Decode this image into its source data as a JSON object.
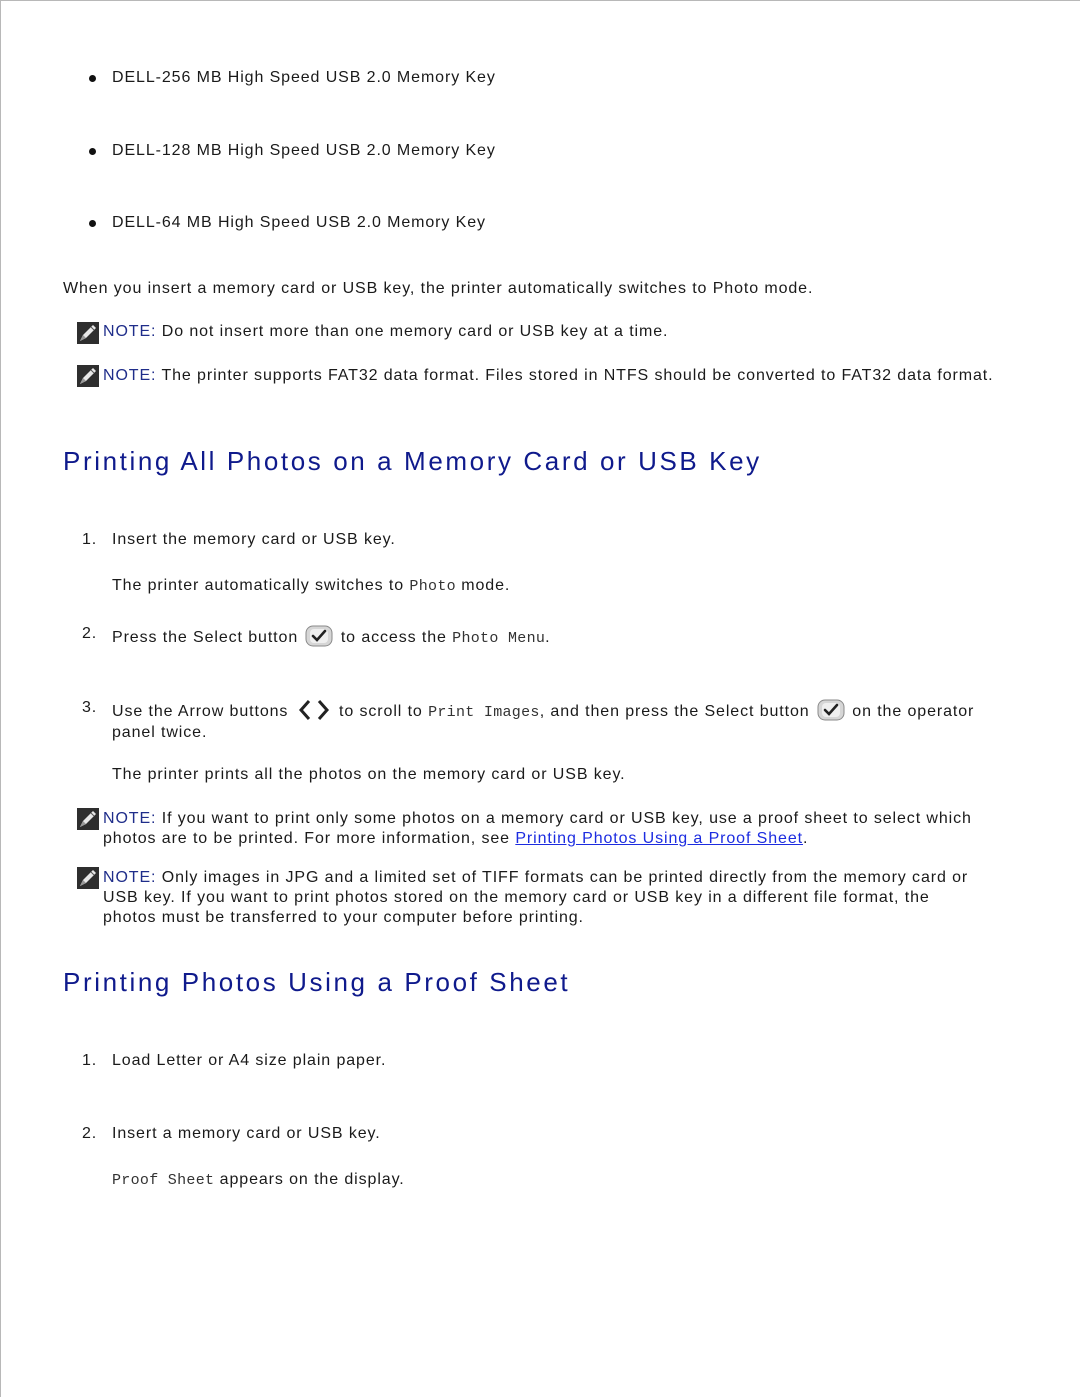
{
  "memory_keys": [
    "DELL-256 MB High Speed USB 2.0 Memory Key",
    "DELL-128 MB High Speed USB 2.0 Memory Key",
    "DELL-64 MB High Speed USB 2.0 Memory Key"
  ],
  "intro": {
    "before": "When you insert a memory card or USB key, the printer automatically switches to ",
    "mode": "Photo",
    "after": " mode."
  },
  "notes_top": [
    {
      "label": "NOTE:",
      "text": " Do not insert more than one memory card or USB key at a time."
    },
    {
      "label": "NOTE:",
      "text": " The printer supports FAT32 data format. Files stored in NTFS should be converted to FAT32 data format."
    }
  ],
  "section1": {
    "heading": "Printing All Photos on a Memory Card or USB Key",
    "step1": {
      "num": "1.",
      "text": "Insert the memory card or USB key."
    },
    "step1_result": {
      "before": "The printer automatically switches to ",
      "code": "Photo",
      "after": " mode."
    },
    "step2": {
      "num": "2.",
      "before": "Press the Select button ",
      "after": " to access the ",
      "code": "Photo Menu",
      "end": "."
    },
    "step3": {
      "num": "3.",
      "before": "Use the Arrow buttons ",
      "mid": " to scroll to ",
      "code": "Print Images",
      "after": ", and then press the Select button ",
      "end": " on the operator panel twice."
    },
    "step3_result": "The printer prints all the photos on the memory card or USB key.",
    "note1": {
      "label": "NOTE:",
      "before": " If you want to print only some photos on a memory card or USB key, use a proof sheet to select which photos are to be printed. For more information, see ",
      "link": "Printing Photos Using a Proof Sheet",
      "after": "."
    },
    "note2": {
      "label": "NOTE:",
      "text": " Only images in JPG and a limited set of TIFF formats can be printed directly from the memory card or USB key. If you want to print photos stored on the memory card or USB key in a different file format, the photos must be transferred to your computer before printing."
    }
  },
  "section2": {
    "heading": "Printing Photos Using a Proof Sheet",
    "step1": {
      "num": "1.",
      "text": "Load Letter or A4 size plain paper."
    },
    "step2": {
      "num": "2.",
      "text": "Insert a memory card or USB key."
    },
    "step2_result": {
      "code": "Proof Sheet",
      "after": " appears on the display."
    }
  },
  "colors": {
    "heading": "#0f1a8c",
    "note_label": "#1f2d8a",
    "link": "#1c2ce0"
  }
}
